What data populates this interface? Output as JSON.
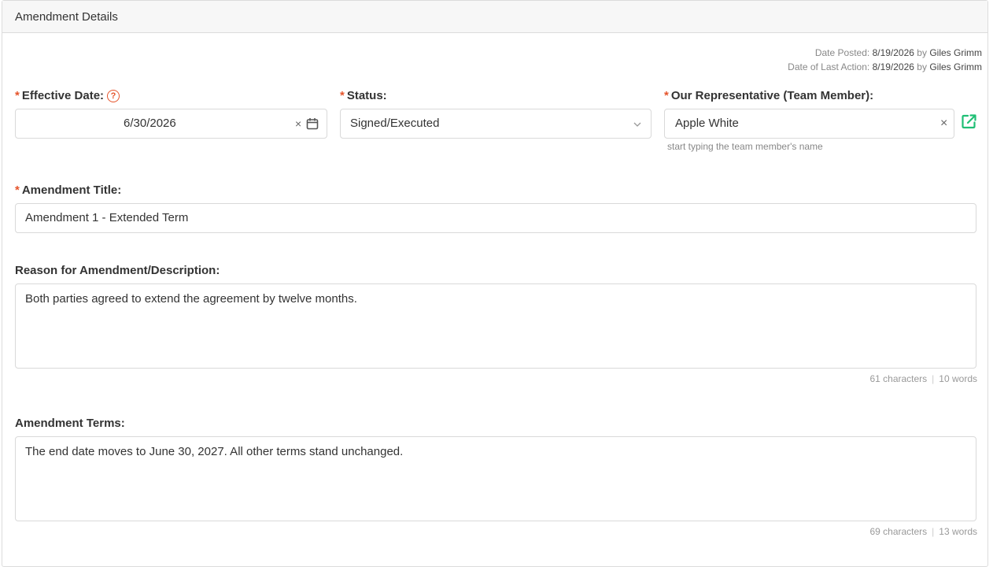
{
  "panel": {
    "title": "Amendment Details"
  },
  "meta": {
    "date_posted_label": "Date Posted:",
    "date_posted": "8/19/2026",
    "posted_by_label": "by",
    "posted_by": "Giles Grimm",
    "last_action_label": "Date of Last Action:",
    "last_action": "8/19/2026",
    "last_action_by_label": "by",
    "last_action_by": "Giles Grimm"
  },
  "required_marker": "*",
  "effective_date": {
    "label": "Effective Date:",
    "value": "6/30/2026",
    "help": "?"
  },
  "status": {
    "label": "Status:",
    "value": "Signed/Executed"
  },
  "representative": {
    "label": "Our Representative (Team Member):",
    "value": "Apple White",
    "hint": "start typing the team member's name"
  },
  "amendment_title": {
    "label": "Amendment Title:",
    "value": "Amendment 1 - Extended Term"
  },
  "reason": {
    "label": "Reason for Amendment/Description:",
    "value": "Both parties agreed to extend the agreement by twelve months.",
    "characters": "61 characters",
    "words": "10 words"
  },
  "terms": {
    "label": "Amendment Terms:",
    "value": "The end date moves to June 30, 2027. All other terms stand unchanged.",
    "characters": "69 characters",
    "words": "13 words"
  },
  "clear_glyph": "×",
  "colors": {
    "required": "#e5542b",
    "link_icon": "#1fbf75"
  }
}
